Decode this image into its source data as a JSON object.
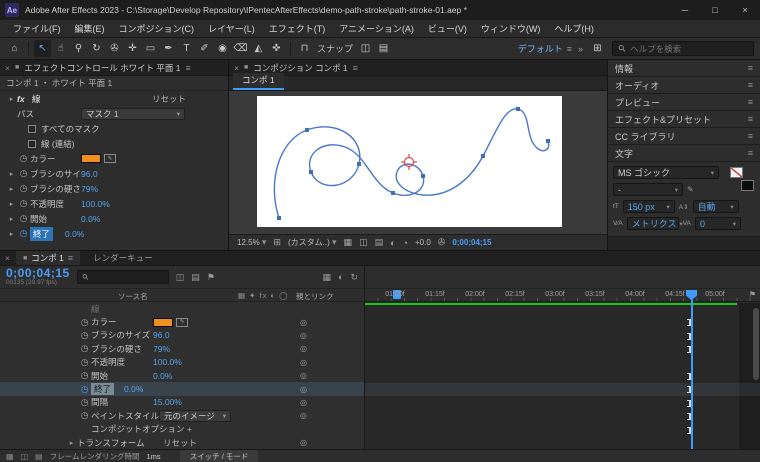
{
  "icons": {
    "app": "Ae",
    "minimize": "─",
    "maximize": "□",
    "close": "×",
    "menu": "≡",
    "chevron": "▾",
    "twirl": "▸",
    "twirl_open": "▼",
    "stopwatch": "◷",
    "pickwhip": "◎",
    "home": "⌂",
    "selection": "↖",
    "hand": "☝",
    "zoom_tool": "⚲",
    "orbit": "↻",
    "camera_tool": "✇",
    "pan_behind": "✛",
    "shape": "▭",
    "pen": "✒",
    "type": "T",
    "brush": "✐",
    "stamp": "◉",
    "eraser": "⌫",
    "roto_brush": "◭",
    "puppet": "✜",
    "snap": "⊓",
    "chevrons": "»",
    "grid": "⊞",
    "flag": "⚑",
    "fx": "fx",
    "plus": "+",
    "eyedropper": "✎",
    "panel": "■",
    "switch_a": "▦",
    "switch_b": "◫",
    "switch_c": "▤",
    "half": "◐",
    "exposure": "◔",
    "size_icon": "tT",
    "leading_icon": "A⇕",
    "kerning_icon": "V⁄A",
    "tracking_icon": "VA",
    "switches_header": "▦ ✦ fx ◐ ◯"
  },
  "titlebar": {
    "title": "Adobe After Effects 2023 - C:\\Storage\\Develop Repository\\IPentecAfterEffects\\demo-path-stroke\\path-stroke-01.aep *"
  },
  "menubar": {
    "items": [
      "ファイル(F)",
      "編集(E)",
      "コンポジション(C)",
      "レイヤー(L)",
      "エフェクト(T)",
      "アニメーション(A)",
      "ビュー(V)",
      "ウィンドウ(W)",
      "ヘルプ(H)"
    ]
  },
  "toolbar": {
    "snap_label": "スナップ",
    "workspace": "デフォルト",
    "search_placeholder": "ヘルプを検索"
  },
  "effect_controls": {
    "tab_title": "エフェクトコントロール ホワイト 平面 1",
    "breadcrumb": "コンポ 1 ・ ホワイト 平面 1",
    "effect_name": "線",
    "reset": "リセット",
    "path_label": "パス",
    "path_value": "マスク 1",
    "all_masks_label": "すべてのマスク",
    "sequential_label": "線 (連結)",
    "color_label": "カラー",
    "color_value": "#ef9021",
    "sliders": [
      {
        "label": "ブラシのサイズ",
        "value": "96.0"
      },
      {
        "label": "ブラシの硬さ",
        "value": "79%"
      },
      {
        "label": "不透明度",
        "value": "100.0%"
      },
      {
        "label": "開始",
        "value": "0.0%"
      },
      {
        "label": "終了",
        "value": "0.0%"
      }
    ]
  },
  "composition": {
    "tab_title": "コンポジション コンポ 1",
    "viewer_tab": "コンポ 1",
    "zoom": "12.5%",
    "resolution": "(カスタム..)",
    "exposure_value": "+0.0",
    "timecode": "0;00;04;15",
    "path_color": "#4a77c9",
    "point_color": "#3f6db8",
    "crosshair_color": "#d9483b"
  },
  "right_panel": {
    "sections": [
      "情報",
      "オーディオ",
      "プレビュー",
      "エフェクト&プリセット",
      "CC ライブラリ"
    ],
    "character": {
      "title": "文字",
      "font_family": "MS ゴシック",
      "font_style": "-",
      "font_size": "150 px",
      "leading": "自動",
      "kerning": "メトリクス",
      "tracking": "0"
    }
  },
  "timeline": {
    "comp_tab": "コンポ 1",
    "render_queue_tab": "レンダーキュー",
    "timecode": "0;00;04;15",
    "frame_info": "00135 (29.97 fps)",
    "source_name_col": "ソース名",
    "parent_col": "親とリンク",
    "effect_group": "線",
    "rows": [
      {
        "label": "カラー",
        "value": ""
      },
      {
        "label": "ブラシのサイズ",
        "value": "96.0"
      },
      {
        "label": "ブラシの硬さ",
        "value": "79%"
      },
      {
        "label": "不透明度",
        "value": "100.0%"
      },
      {
        "label": "開始",
        "value": "0.0%"
      },
      {
        "label": "終了",
        "value": "0.0%"
      },
      {
        "label": "間隔",
        "value": "15.00%"
      },
      {
        "label": "ペイントスタイル",
        "value": "元のイメージ"
      },
      {
        "label": "コンポジットオプション",
        "value": "+"
      },
      {
        "label": "トランスフォーム",
        "value": "リセット"
      }
    ],
    "ruler": [
      "01:00f",
      "01:15f",
      "02:00f",
      "02:15f",
      "03:00f",
      "03:15f",
      "04:00f",
      "04:15f",
      "05:00f"
    ],
    "footer": {
      "render_label": "フレームレンダリング時間",
      "render_value": "1ms",
      "switch_mode": "スイッチ / モード"
    }
  }
}
